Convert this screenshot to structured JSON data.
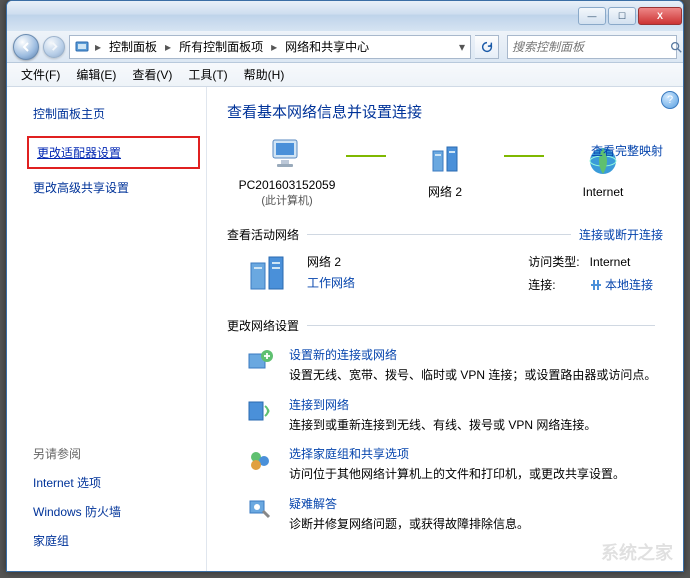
{
  "titlebar": {
    "min": "—",
    "max": "☐",
    "close": "X"
  },
  "address": {
    "crumbs": [
      "控制面板",
      "所有控制面板项",
      "网络和共享中心"
    ],
    "search_placeholder": "搜索控制面板"
  },
  "menu": [
    "文件(F)",
    "编辑(E)",
    "查看(V)",
    "工具(T)",
    "帮助(H)"
  ],
  "sidebar": {
    "home": "控制面板主页",
    "adapter": "更改适配器设置",
    "advshare": "更改高级共享设置",
    "seealso_hdr": "另请参阅",
    "seealso": [
      "Internet 选项",
      "Windows 防火墙",
      "家庭组"
    ]
  },
  "main": {
    "title": "查看基本网络信息并设置连接",
    "fullmap": "查看完整映射",
    "nodes": {
      "pc": "PC201603152059",
      "pc_sub": "(此计算机)",
      "net": "网络  2",
      "internet": "Internet"
    },
    "active_hdr": "查看活动网络",
    "active_act": "连接或断开连接",
    "active": {
      "name": "网络  2",
      "type": "工作网络",
      "access_lbl": "访问类型:",
      "access_val": "Internet",
      "conn_lbl": "连接:",
      "conn_val": "本地连接"
    },
    "change_hdr": "更改网络设置",
    "settings": [
      {
        "title": "设置新的连接或网络",
        "desc": "设置无线、宽带、拨号、临时或 VPN 连接；或设置路由器或访问点。",
        "icon": "new-conn"
      },
      {
        "title": "连接到网络",
        "desc": "连接到或重新连接到无线、有线、拨号或 VPN 网络连接。",
        "icon": "connect"
      },
      {
        "title": "选择家庭组和共享选项",
        "desc": "访问位于其他网络计算机上的文件和打印机，或更改共享设置。",
        "icon": "homegroup"
      },
      {
        "title": "疑难解答",
        "desc": "诊断并修复网络问题，或获得故障排除信息。",
        "icon": "troubleshoot"
      }
    ]
  },
  "watermark": "系统之家"
}
